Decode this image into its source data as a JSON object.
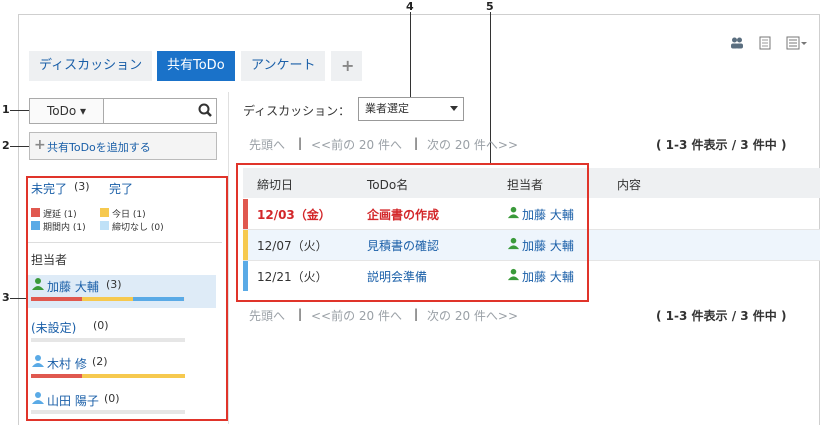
{
  "callouts": [
    "1",
    "2",
    "3",
    "4",
    "5"
  ],
  "header_icons": [
    "users-icon",
    "print-icon",
    "menu-icon"
  ],
  "tabs": [
    {
      "label": "ディスカッション",
      "active": false
    },
    {
      "label": "共有ToDo",
      "active": true
    },
    {
      "label": "アンケート",
      "active": false
    },
    {
      "label": "+",
      "active": false
    }
  ],
  "sidebar": {
    "search_dropdown": "ToDo ▾",
    "search_placeholder": "",
    "add_button": "共有ToDoを追加する",
    "incomplete_label": "未完了",
    "incomplete_count": "(3)",
    "complete_label": "完了",
    "legend": [
      {
        "label": "遅延 (1)",
        "color": "#e0584f"
      },
      {
        "label": "今日 (1)",
        "color": "#f6c94f"
      },
      {
        "label": "期間内 (1)",
        "color": "#5aaae6"
      },
      {
        "label": "締切なし (0)",
        "color": "#bfe1f7"
      }
    ],
    "assignee_heading": "担当者",
    "assignees": [
      {
        "name": "加藤 大輔",
        "count": "(3)",
        "fractions": [
          0.333,
          0.333,
          0.334
        ],
        "selected": true
      },
      {
        "name": "(未設定)",
        "count": "(0)",
        "fractions": [
          0,
          0,
          0
        ],
        "selected": false
      },
      {
        "name": "木村 修",
        "count": "(2)",
        "fractions": [
          0.333,
          0.667,
          0
        ],
        "selected": false
      },
      {
        "name": "山田 陽子",
        "count": "(0)",
        "fractions": [
          0,
          0,
          0
        ],
        "selected": false
      }
    ]
  },
  "main": {
    "filter_label": "ディスカッション：",
    "filter_value": "業者選定",
    "pager": {
      "first": "先頭へ",
      "sep": "|",
      "prev": "<<前の 20 件へ",
      "next": "次の 20 件へ>>"
    },
    "count_text": "( 1-3 件表示 / 3 件中 )",
    "columns": [
      "締切日",
      "ToDo名",
      "担当者",
      "内容"
    ],
    "rows": [
      {
        "date": "12/03（金）",
        "name": "企画書の作成",
        "assignee": "加藤 大輔",
        "status_color": "#e0584f",
        "overdue": true
      },
      {
        "date": "12/07（火）",
        "name": "見積書の確認",
        "assignee": "加藤 大輔",
        "status_color": "#f6c94f",
        "overdue": false
      },
      {
        "date": "12/21（火）",
        "name": "説明会準備",
        "assignee": "加藤 大輔",
        "status_color": "#5aaae6",
        "overdue": false
      }
    ]
  }
}
